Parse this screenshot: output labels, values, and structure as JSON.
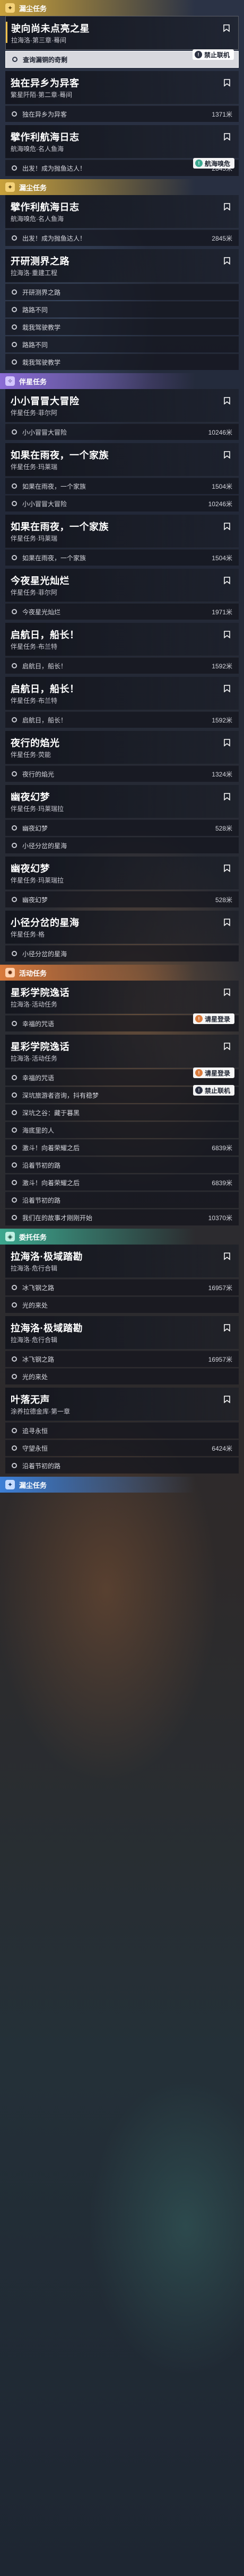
{
  "sections": [
    {
      "kind": "story",
      "label": "漏尘任务",
      "icon": "✦"
    },
    {
      "kind": "story",
      "label": "漏尘任务",
      "icon": "✦"
    },
    {
      "kind": "comp",
      "label": "伴星任务",
      "icon": "✧"
    },
    {
      "kind": "event",
      "label": "活动任务",
      "icon": "✹"
    },
    {
      "kind": "daily",
      "label": "委托任务",
      "icon": "◈"
    },
    {
      "kind": "comm",
      "label": "漏尘任务",
      "icon": "✦"
    }
  ],
  "quests": [
    {
      "title": "驶向尚未点亮之星",
      "sub": "拉海洛·第三章·蓦间",
      "selected": true,
      "objectives": [
        {
          "text": "查询漏铜的奇剩",
          "dist": "",
          "selected": true,
          "hint": "禁止联机",
          "hint_color": "dark"
        }
      ]
    },
    {
      "title": "独在异乡为异客",
      "sub": "繁星阡陌·第二章·蓦间",
      "selected": false,
      "objectives": [
        {
          "text": "独在异乡为异客",
          "dist": "1371米",
          "selected": false
        }
      ]
    },
    {
      "title": "擘作利航海日志",
      "sub": "航海嗅危·名人鱼海",
      "selected": false,
      "objectives": [
        {
          "text": "出发！成为抛鱼达人！",
          "dist": "2845米",
          "selected": false,
          "hint": "航海嗅危",
          "hint_color": "green"
        }
      ]
    },
    {
      "title": "擘作利航海日志",
      "sub": "航海嗅危·名人鱼海",
      "selected": false,
      "objectives": [
        {
          "text": "出发！成为抛鱼达人！",
          "dist": "2845米",
          "selected": false
        }
      ]
    },
    {
      "title": "开研测界之路",
      "sub": "拉海洛·重建工程",
      "selected": false,
      "objectives": [
        {
          "text": "开研测界之路",
          "dist": "",
          "selected": false
        },
        {
          "text": "路路不同",
          "dist": "",
          "selected": false
        },
        {
          "text": "栽我驾驶教学",
          "dist": "",
          "selected": false
        },
        {
          "text": "路路不同",
          "dist": "",
          "selected": false
        },
        {
          "text": "栽我驾驶教学",
          "dist": "",
          "selected": false
        }
      ]
    },
    {
      "title": "小小冒冒大冒险",
      "sub": "伴星任务·菲尔阿",
      "selected": false,
      "objectives": [
        {
          "text": "小小冒冒大冒险",
          "dist": "10246米",
          "selected": false
        }
      ]
    },
    {
      "title": "如果在雨夜，一个家族",
      "sub": "伴星任务·玛莱瑞",
      "selected": false,
      "objectives": [
        {
          "text": "如果在雨夜，一个家族",
          "dist": "1504米",
          "selected": false
        },
        {
          "text": "小小冒冒大冒险",
          "dist": "10246米",
          "selected": false
        }
      ]
    },
    {
      "title": "如果在雨夜，一个家族",
      "sub": "伴星任务·玛莱瑞",
      "selected": false,
      "objectives": [
        {
          "text": "如果在雨夜，一个家族",
          "dist": "1504米",
          "selected": false
        }
      ]
    },
    {
      "title": "今夜星光灿烂",
      "sub": "伴星任务·菲尔阿",
      "selected": false,
      "objectives": [
        {
          "text": "今夜星光灿烂",
          "dist": "1971米",
          "selected": false
        }
      ]
    },
    {
      "title": "启航日，船长！",
      "sub": "伴星任务·布兰特",
      "selected": false,
      "objectives": [
        {
          "text": "启航日，船长！",
          "dist": "1592米",
          "selected": false
        }
      ]
    },
    {
      "title": "启航日，船长！",
      "sub": "伴星任务·布兰特",
      "selected": false,
      "objectives": [
        {
          "text": "启航日，船长！",
          "dist": "1592米",
          "selected": false
        }
      ]
    },
    {
      "title": "夜行的焰光",
      "sub": "伴星任务·荧能",
      "selected": false,
      "objectives": [
        {
          "text": "夜行的焰光",
          "dist": "1324米",
          "selected": false
        }
      ]
    },
    {
      "title": "幽夜幻梦",
      "sub": "伴星任务·玛莱瑞拉",
      "selected": false,
      "objectives": [
        {
          "text": "幽夜幻梦",
          "dist": "528米",
          "selected": false
        },
        {
          "text": "小径分岔的星海",
          "dist": "",
          "selected": false
        }
      ]
    },
    {
      "title": "幽夜幻梦",
      "sub": "伴星任务·玛莱瑞拉",
      "selected": false,
      "objectives": [
        {
          "text": "幽夜幻梦",
          "dist": "528米",
          "selected": false
        }
      ]
    },
    {
      "title": "小径分岔的星海",
      "sub": "伴星任务·格",
      "selected": false,
      "objectives": [
        {
          "text": "小径分岔的星海",
          "dist": "",
          "selected": false
        }
      ]
    },
    {
      "title": "星彩学院逸话",
      "sub": "拉海洛·活动任务",
      "selected": false,
      "objectives": [
        {
          "text": "幸福的咒语",
          "dist": "",
          "selected": false,
          "hint": "请星登录",
          "hint_color": "orange"
        }
      ]
    },
    {
      "title": "星彩学院逸话",
      "sub": "拉海洛·活动任务",
      "selected": false,
      "objectives": [
        {
          "text": "幸福的咒语",
          "dist": "",
          "selected": false,
          "hint": "请星登录",
          "hint_color": "orange"
        },
        {
          "text": "深坑旅游者咨询，抖有稳梦",
          "dist": "",
          "selected": false,
          "hint": "禁止联机",
          "hint_color": "dark"
        },
        {
          "text": "深坑之谷：藏于暮黑",
          "dist": "",
          "selected": false
        },
        {
          "text": "海底里的人",
          "dist": "",
          "selected": false
        },
        {
          "text": "激斗！向着荣耀之后",
          "dist": "6839米",
          "selected": false
        },
        {
          "text": "沿着节初的路",
          "dist": "",
          "selected": false
        },
        {
          "text": "激斗！向着荣耀之后",
          "dist": "6839米",
          "selected": false
        },
        {
          "text": "沿着节初的路",
          "dist": "",
          "selected": false
        },
        {
          "text": "我们在的故事才刚刚开始",
          "dist": "10370米",
          "selected": false
        }
      ]
    },
    {
      "title": "拉海洛·极域踏勘",
      "sub": "拉海洛·危行合辑",
      "selected": false,
      "objectives": [
        {
          "text": "冰飞钢之路",
          "dist": "16957米",
          "selected": false
        },
        {
          "text": "光的来处",
          "dist": "",
          "selected": false
        }
      ]
    },
    {
      "title": "拉海洛·极域踏勘",
      "sub": "拉海洛·危行合辑",
      "selected": false,
      "objectives": [
        {
          "text": "冰飞钢之路",
          "dist": "16957米",
          "selected": false
        },
        {
          "text": "光的来处",
          "dist": "",
          "selected": false
        }
      ]
    },
    {
      "title": "叶落无声",
      "sub": "涂养拉德金库·第一章",
      "selected": false,
      "objectives": [
        {
          "text": "追寻永恒",
          "dist": "",
          "selected": false
        },
        {
          "text": "守望永恒",
          "dist": "6424米",
          "selected": false
        },
        {
          "text": "沿着节初的路",
          "dist": "",
          "selected": false
        }
      ]
    }
  ]
}
